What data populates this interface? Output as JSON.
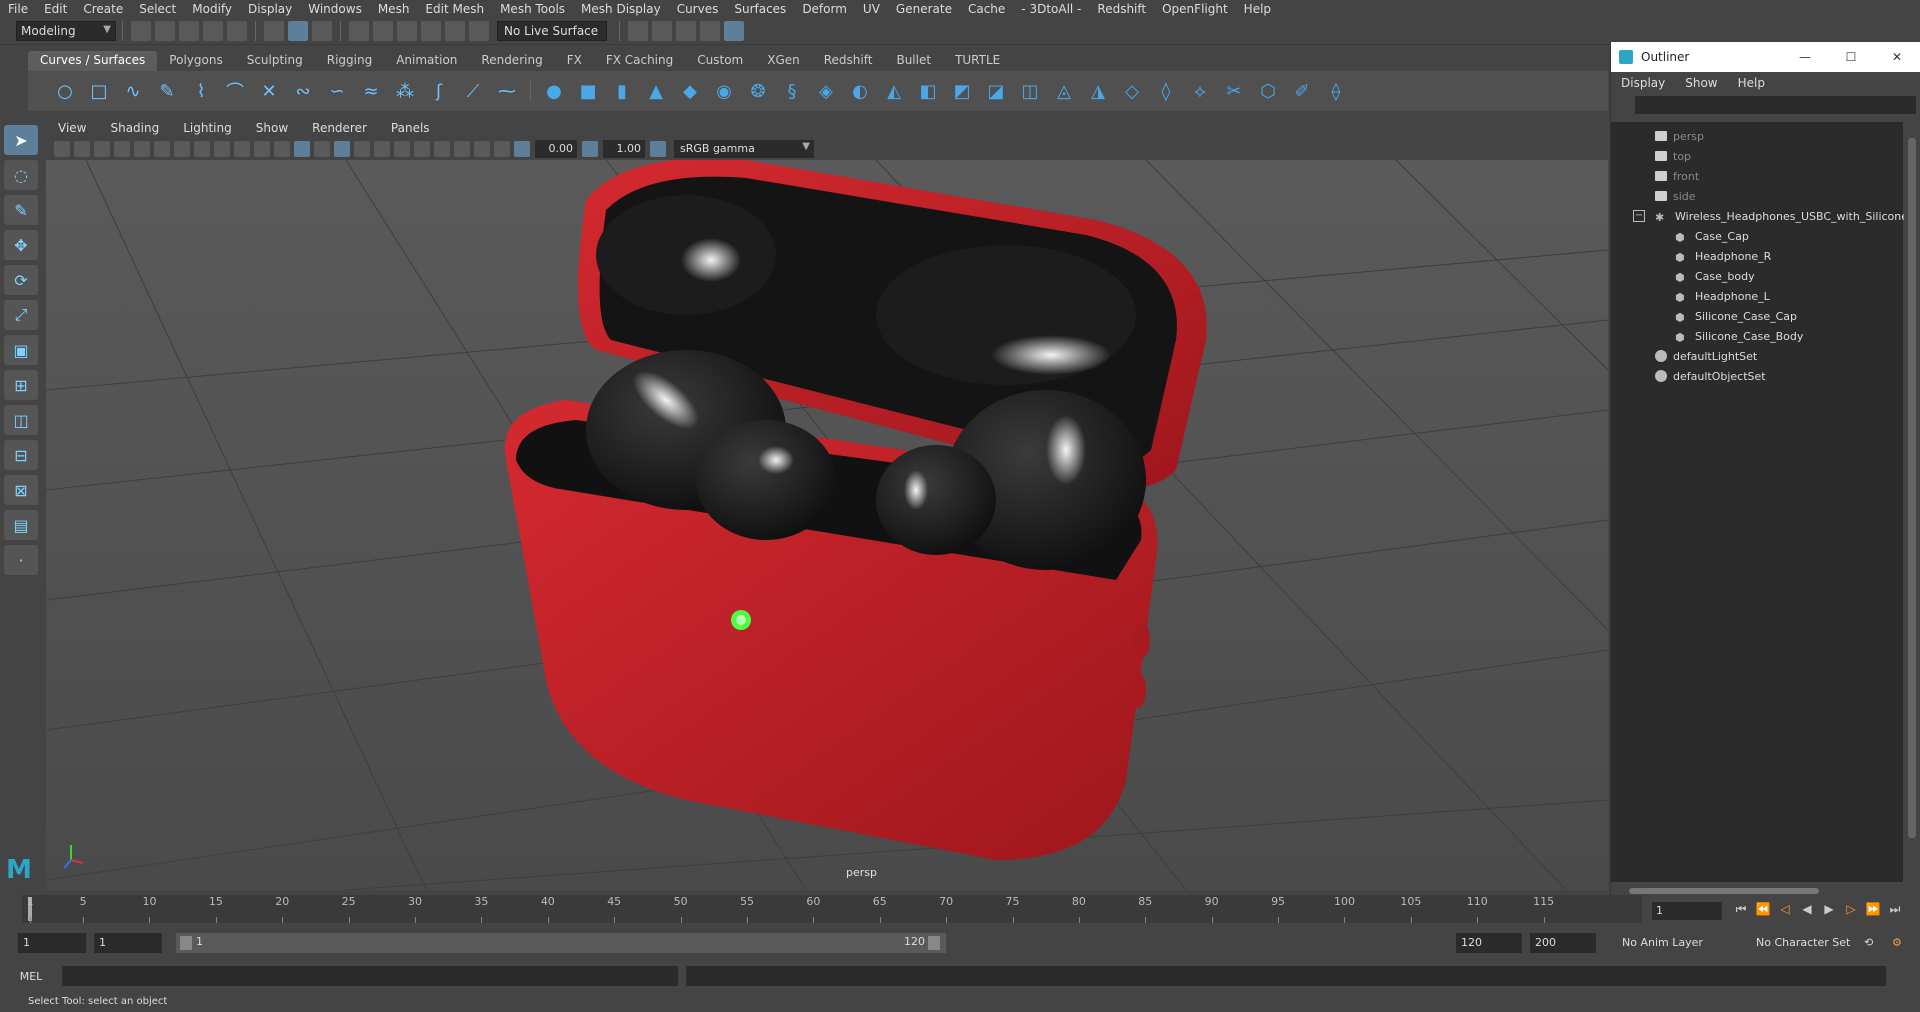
{
  "menubar": [
    "File",
    "Edit",
    "Create",
    "Select",
    "Modify",
    "Display",
    "Windows",
    "Mesh",
    "Edit Mesh",
    "Mesh Tools",
    "Mesh Display",
    "Curves",
    "Surfaces",
    "Deform",
    "UV",
    "Generate",
    "Cache",
    "- 3DtoAll -",
    "Redshift",
    "OpenFlight",
    "Help"
  ],
  "status": {
    "mode": "Modeling",
    "live_surface": "No Live Surface"
  },
  "shelf_tabs": [
    "Curves / Surfaces",
    "Polygons",
    "Sculpting",
    "Rigging",
    "Animation",
    "Rendering",
    "FX",
    "FX Caching",
    "Custom",
    "XGen",
    "Redshift",
    "Bullet",
    "TURTLE"
  ],
  "panel_menu": [
    "View",
    "Shading",
    "Lighting",
    "Show",
    "Renderer",
    "Panels"
  ],
  "panel_bar": {
    "exposure": "0.00",
    "gamma_value": "1.00",
    "color_space": "sRGB gamma"
  },
  "viewport": {
    "camera_label": "persp"
  },
  "outliner": {
    "title": "Outliner",
    "menu": [
      "Display",
      "Show",
      "Help"
    ],
    "cameras": [
      "persp",
      "top",
      "front",
      "side"
    ],
    "group": "Wireless_Headphones_USBC_with_Silicone_",
    "children": [
      "Case_Cap",
      "Headphone_R",
      "Case_body",
      "Headphone_L",
      "Silicone_Case_Cap",
      "Silicone_Case_Body"
    ],
    "sets": [
      "defaultLightSet",
      "defaultObjectSet"
    ]
  },
  "timeline": {
    "ticks": [
      "1",
      "5",
      "10",
      "15",
      "20",
      "25",
      "30",
      "35",
      "40",
      "45",
      "50",
      "55",
      "60",
      "65",
      "70",
      "75",
      "80",
      "85",
      "90",
      "95",
      "100",
      "105",
      "110",
      "115"
    ],
    "current_frame": "1"
  },
  "range": {
    "start": "1",
    "playback_start": "1",
    "range_start": "1",
    "range_end": "120",
    "playback_end": "120",
    "end": "200",
    "anim_layer": "No Anim Layer",
    "char_set": "No Character Set"
  },
  "cmd": {
    "label": "MEL"
  },
  "help_line": "Select Tool: select an object",
  "colors": {
    "accent": "#5d7f99",
    "case_red": "#c8202a",
    "bud_black": "#1a1a1a",
    "led_green": "#4cff44"
  }
}
